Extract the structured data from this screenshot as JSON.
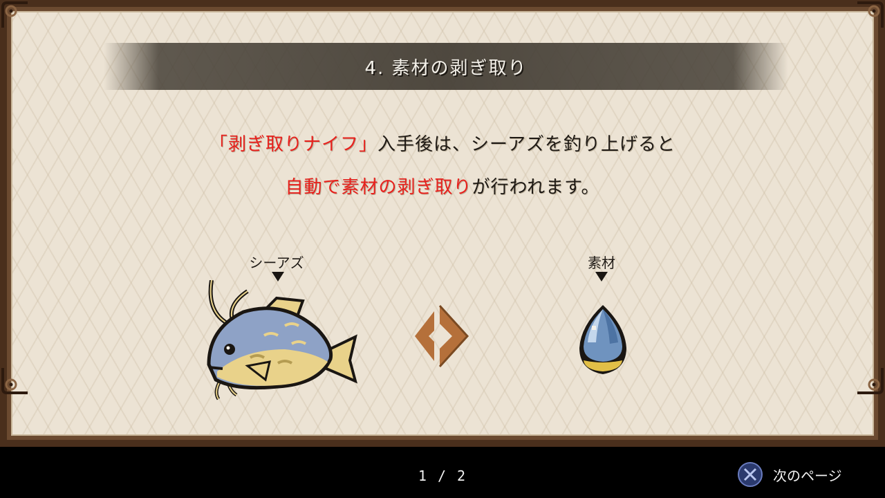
{
  "title": "4. 素材の剥ぎ取り",
  "body": {
    "line1_highlight": "「剥ぎ取りナイフ」",
    "line1_rest": "入手後は、シーアズを釣り上げると",
    "line2_highlight": "自動で素材の剥ぎ取り",
    "line2_rest": "が行われます。"
  },
  "illustration": {
    "left_label": "シーアズ",
    "right_label": "素材",
    "left_icon": "fish-icon",
    "center_icon": "chevron-right-icon",
    "right_icon": "material-gem-icon"
  },
  "footer": {
    "page_indicator": "1 / 2",
    "next_label": "次のページ",
    "next_button_icon": "cross-button-icon"
  },
  "colors": {
    "highlight": "#e8201c",
    "paper": "#ece3d4",
    "frame": "#4a2f1c",
    "chevron": "#b5703a",
    "gem_blue": "#6f93bf",
    "fish_blue": "#8ea2c6",
    "fish_yellow": "#e9d28a"
  }
}
